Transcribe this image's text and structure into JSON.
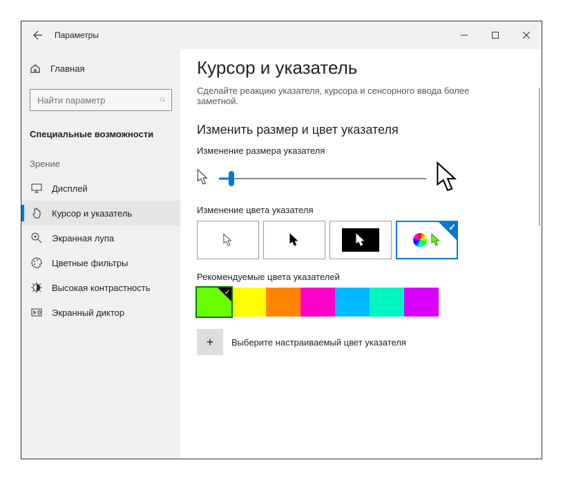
{
  "titlebar": {
    "app_name": "Параметры"
  },
  "sidebar": {
    "home": "Главная",
    "search_placeholder": "Найти параметр",
    "section": "Специальные возможности",
    "group": "Зрение",
    "items": [
      {
        "label": "Дисплей"
      },
      {
        "label": "Курсор и указатель"
      },
      {
        "label": "Экранная лупа"
      },
      {
        "label": "Цветные фильтры"
      },
      {
        "label": "Высокая контрастность"
      },
      {
        "label": "Экранный диктор"
      }
    ]
  },
  "page": {
    "title": "Курсор и указатель",
    "subtitle": "Сделайте реакцию указателя, курсора и сенсорного ввода более заметной.",
    "section_title": "Изменить размер и цвет указателя",
    "size_label": "Изменение размера указателя",
    "color_label": "Изменение цвета указателя",
    "recommended_label": "Рекомендуемые цвета указателей",
    "custom_label": "Выберите настраиваемый цвет указателя",
    "swatches": [
      "#6aff00",
      "#ffff00",
      "#ff8400",
      "#ff00c8",
      "#00baff",
      "#00f6c0",
      "#d800ff"
    ]
  }
}
